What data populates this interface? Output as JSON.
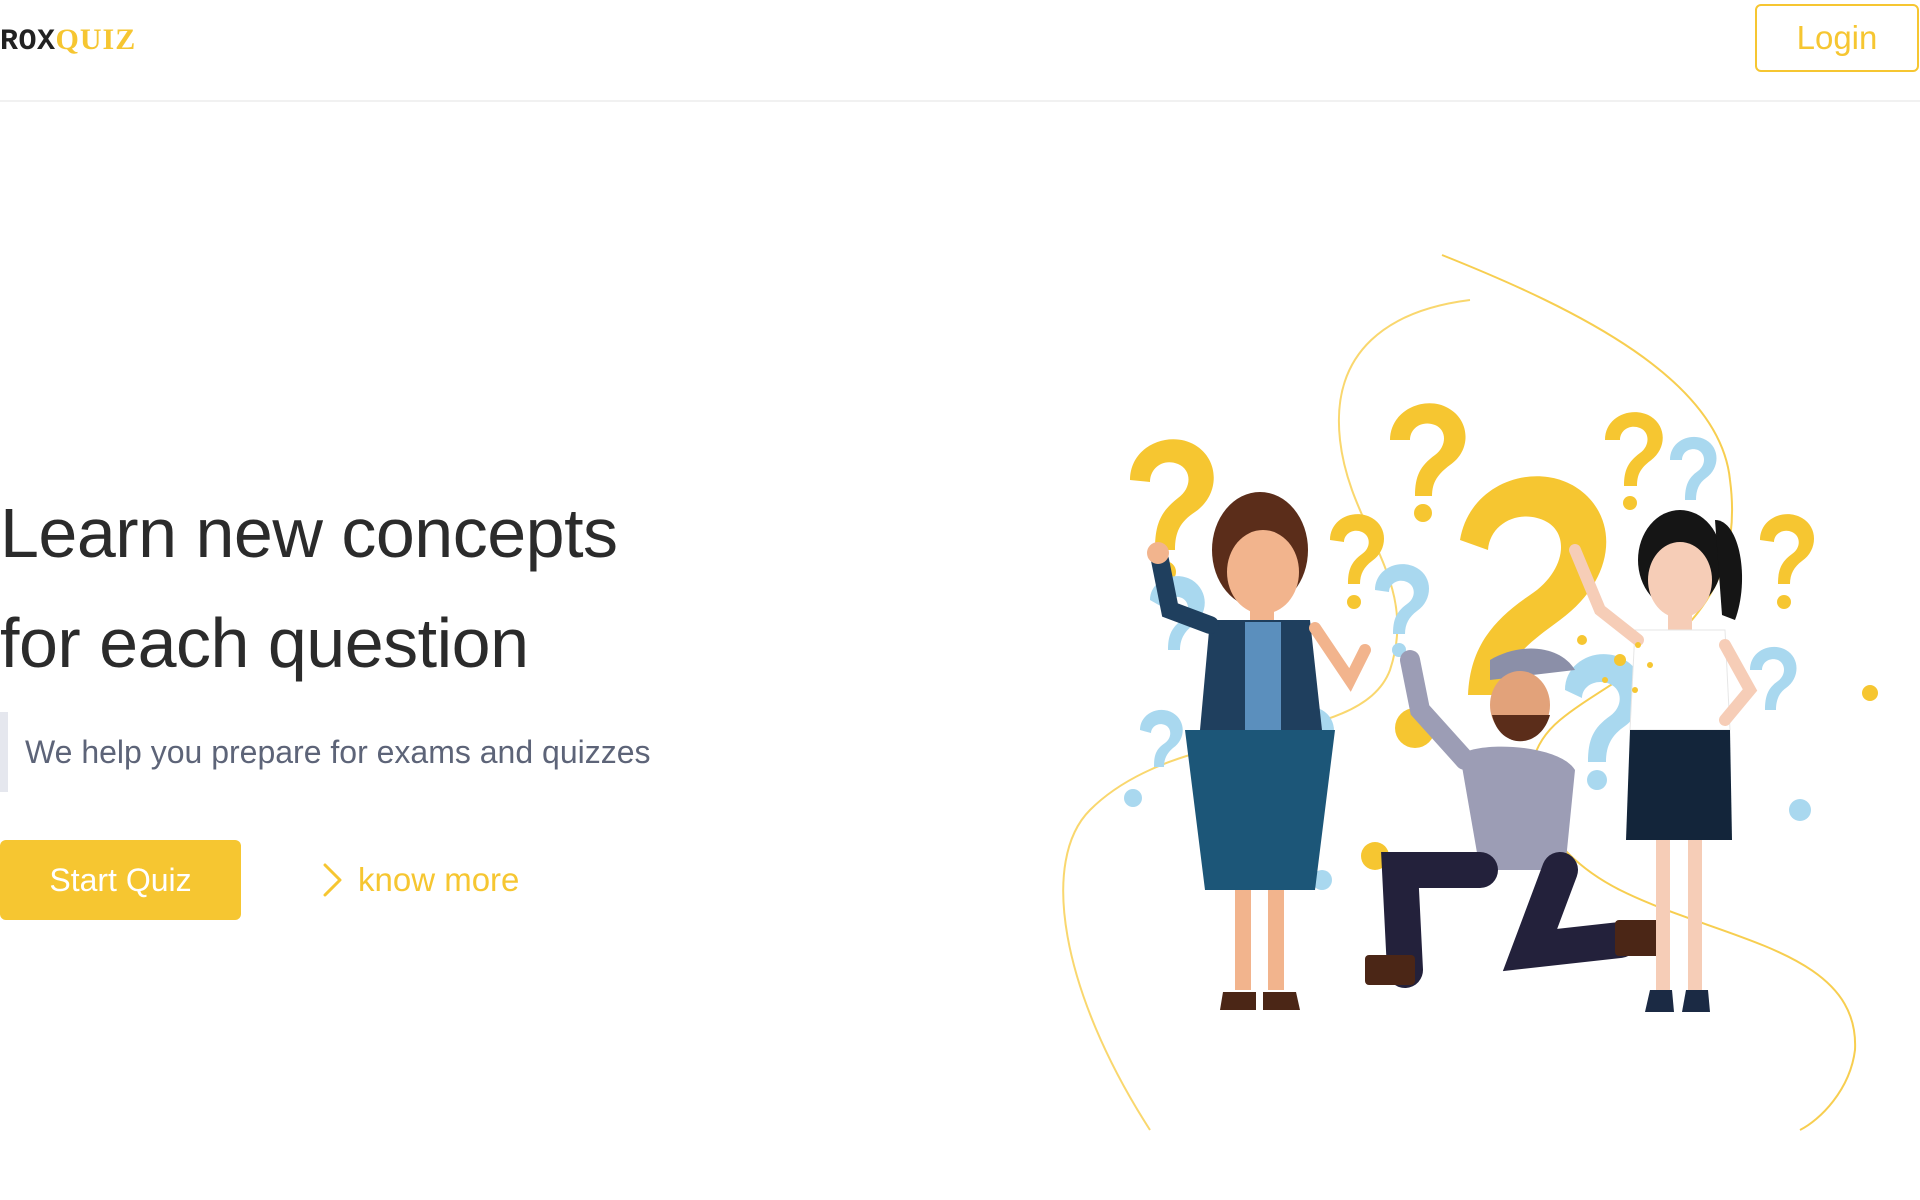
{
  "header": {
    "logo_part_a": "ROX",
    "logo_part_b": "QUIZ",
    "login_label": "Login"
  },
  "hero": {
    "headline_line1": "Learn new concepts",
    "headline_line2": "for each question",
    "subtitle": "We help you prepare for exams and quizzes",
    "start_label": "Start Quiz",
    "know_more_label": "know more",
    "know_more_icon": "chevron-right-icon"
  },
  "illustration": {
    "description_icon": "question-mark-people-illustration"
  },
  "colors": {
    "accent": "#f6c631",
    "text_dark": "#2b2b2b",
    "text_muted": "#5d6478",
    "quote_bar": "#e5e7ee",
    "header_border": "#f1f1f1"
  }
}
